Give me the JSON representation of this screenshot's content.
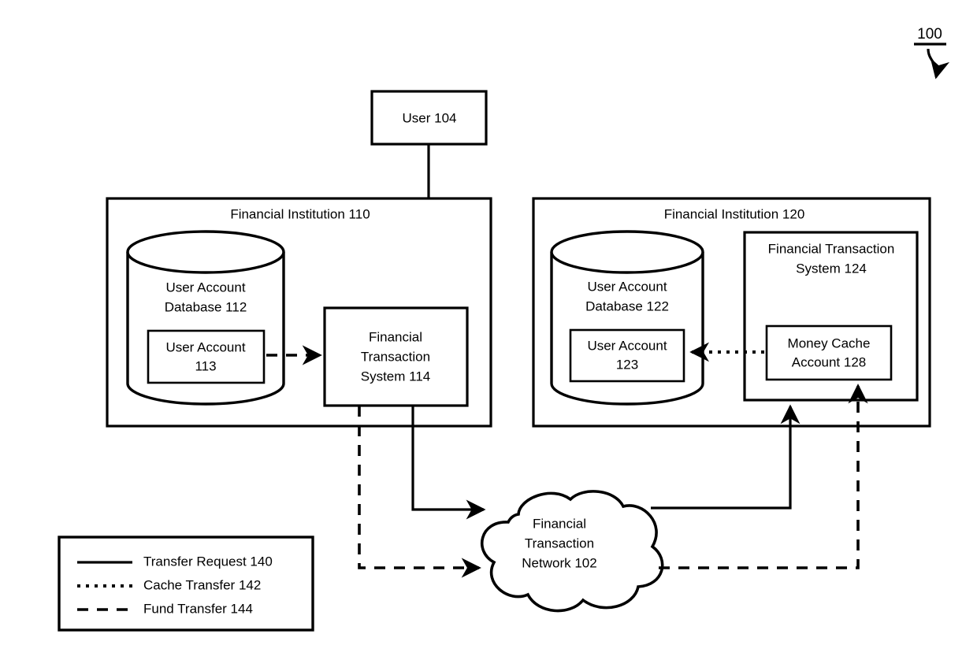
{
  "figure": {
    "number": "100",
    "title_label": "100"
  },
  "nodes": {
    "user": {
      "label": "User 104"
    },
    "fi_left": {
      "label": "Financial Institution 110"
    },
    "fi_right": {
      "label": "Financial Institution 120"
    },
    "db_left": {
      "line1": "User Account",
      "line2": "Database 112"
    },
    "db_right": {
      "line1": "User Account",
      "line2": "Database 122"
    },
    "account_left": {
      "line1": "User Account",
      "line2": "113"
    },
    "account_right": {
      "line1": "User Account",
      "line2": "123"
    },
    "fts_left": {
      "line1": "Financial",
      "line2": "Transaction",
      "line3": "System 114"
    },
    "fts_right": {
      "line1": "Financial Transaction",
      "line2": "System 124"
    },
    "money_cache": {
      "line1": "Money Cache",
      "line2": "Account 128"
    },
    "network": {
      "line1": "Financial",
      "line2": "Transaction",
      "line3": "Network 102"
    }
  },
  "legend": {
    "items": [
      {
        "style": "solid",
        "label": "Transfer Request 140"
      },
      {
        "style": "dotted",
        "label": "Cache Transfer 142"
      },
      {
        "style": "dashed",
        "label": "Fund Transfer 144"
      }
    ]
  },
  "colors": {
    "stroke": "#000000",
    "background": "#ffffff"
  }
}
